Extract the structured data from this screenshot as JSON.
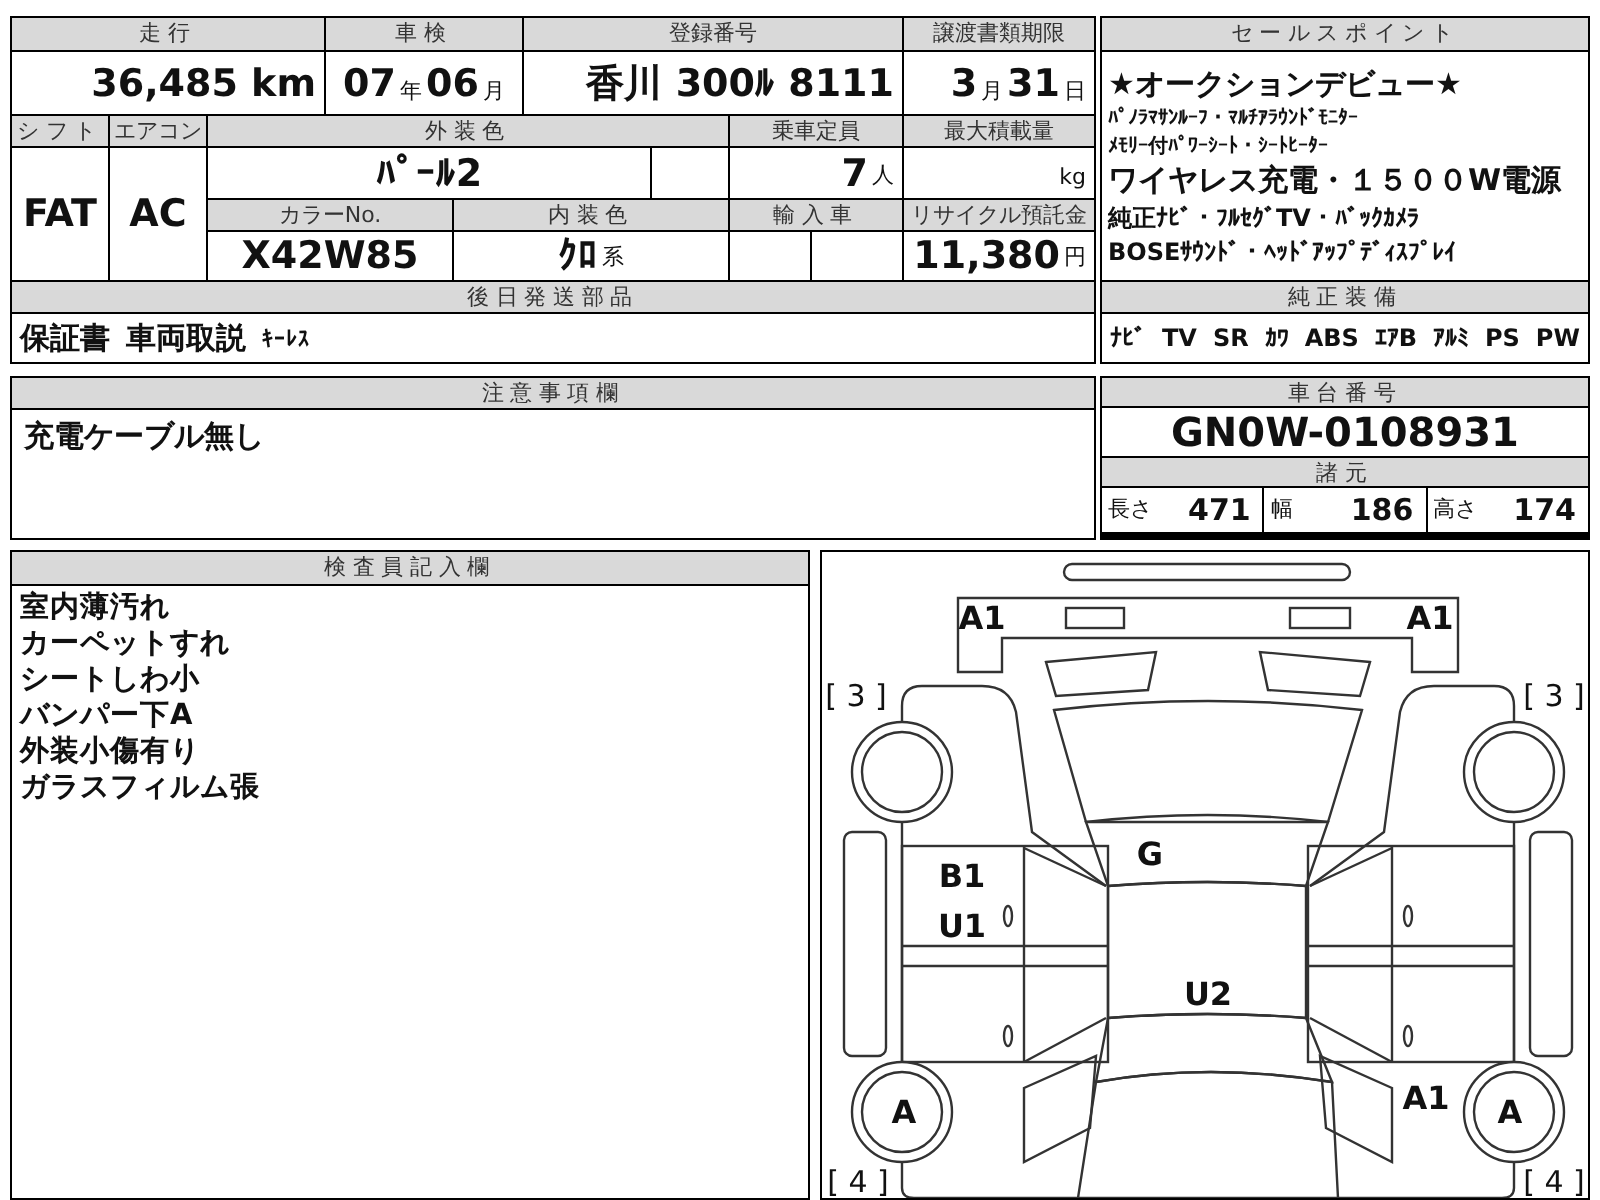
{
  "vehicle": {
    "fields": [
      {
        "label": "走行",
        "parts": [
          {
            "text": "36,485 km",
            "kind": "num"
          }
        ]
      },
      {
        "label": "車検",
        "parts": [
          {
            "text": "07",
            "kind": "num"
          },
          {
            "text": "年",
            "kind": "unit"
          },
          {
            "text": "06",
            "kind": "num"
          },
          {
            "text": "月",
            "kind": "unit"
          }
        ]
      },
      {
        "label": "登録番号",
        "parts": [
          {
            "text": "香川 300ﾙ 8111",
            "kind": "num"
          }
        ]
      },
      {
        "label": "譲渡書類期限",
        "parts": [
          {
            "text": "3",
            "kind": "num"
          },
          {
            "text": "月",
            "kind": "unit"
          },
          {
            "text": "31",
            "kind": "num"
          },
          {
            "text": "日",
            "kind": "unit"
          }
        ]
      },
      {
        "label": "シフト",
        "parts": [
          {
            "text": "FAT",
            "kind": "num"
          }
        ]
      },
      {
        "label": "エアコン",
        "parts": [
          {
            "text": "AC",
            "kind": "num"
          }
        ]
      },
      {
        "label": "外装色",
        "parts": [
          {
            "text": "ﾊﾟｰﾙ2",
            "kind": "num"
          }
        ]
      },
      {
        "label": "乗車定員",
        "parts": [
          {
            "text": "7",
            "kind": "num"
          },
          {
            "text": "人",
            "kind": "unit"
          }
        ]
      },
      {
        "label": "最大積載量",
        "parts": [
          {
            "text": "kg",
            "kind": "unit"
          }
        ]
      },
      {
        "label": "カラーNo.",
        "parts": [
          {
            "text": "X42W85",
            "kind": "num"
          }
        ]
      },
      {
        "label": "内装色",
        "parts": [
          {
            "text": "ｸﾛ",
            "kind": "num"
          },
          {
            "text": "系",
            "kind": "unit"
          }
        ]
      },
      {
        "label": "輸入車"
      },
      {
        "label": "リサイクル預託金",
        "parts": [
          {
            "text": "11,380",
            "kind": "num"
          },
          {
            "text": "円",
            "kind": "unit"
          }
        ]
      }
    ],
    "parts_to_follow": {
      "label": "後日発送部品",
      "items": [
        {
          "text": "保証書",
          "kind": "large"
        },
        {
          "text": "車両取説",
          "kind": "large"
        },
        {
          "text": "ｷｰﾚｽ",
          "kind": "small"
        }
      ]
    }
  },
  "sales_points": {
    "label": "セールスポイント",
    "lines": [
      {
        "text": "★オークションデビュー★",
        "kind": "large"
      },
      {
        "text": "ﾊﾟﾉﾗﾏｻﾝﾙｰﾌ・ﾏﾙﾁｱﾗｳﾝﾄﾞﾓﾆﾀｰ",
        "kind": "small"
      },
      {
        "text": "ﾒﾓﾘｰ付ﾊﾟﾜｰｼｰﾄ・ｼｰﾄﾋｰﾀｰ",
        "kind": "small"
      },
      {
        "text": "ワイヤレス充電・１５００W電源",
        "kind": "large"
      },
      {
        "text": "純正ﾅﾋﾞ・ﾌﾙｾｸﾞTV・ﾊﾞｯｸｶﾒﾗ",
        "kind": "medium"
      },
      {
        "text": "BOSEｻｳﾝﾄﾞ・ﾍｯﾄﾞｱｯﾌﾟﾃﾞｨｽﾌﾟﾚｲ",
        "kind": "medium"
      }
    ]
  },
  "equipment": {
    "label": "純正装備",
    "items": [
      "ﾅﾋﾞ",
      "TV",
      "SR",
      "ｶﾜ",
      "ABS",
      "ｴｱB",
      "ｱﾙﾐ",
      "PS",
      "PW"
    ]
  },
  "notes": {
    "label": "注意事項欄",
    "text": "充電ケーブル無し"
  },
  "chassis": {
    "label": "車台番号",
    "value": "GN0W-0108931"
  },
  "specs": {
    "label": "諸元",
    "items": [
      {
        "label": "長さ",
        "value": "471"
      },
      {
        "label": "幅",
        "value": "186"
      },
      {
        "label": "高さ",
        "value": "174"
      }
    ]
  },
  "inspector": {
    "label": "検査員記入欄",
    "lines": [
      "室内薄汚れ",
      "カーペットすれ",
      "シートしわ小",
      "バンパー下A",
      "外装小傷有り",
      "ガラスフィルム張"
    ]
  },
  "diagram": {
    "marks": [
      {
        "text": "A1"
      },
      {
        "text": "A1"
      },
      {
        "text": "[ 3 ]"
      },
      {
        "text": "[ 3 ]"
      },
      {
        "text": "G"
      },
      {
        "text": "B1"
      },
      {
        "text": "U1"
      },
      {
        "text": "U2"
      },
      {
        "text": "A1"
      },
      {
        "text": "A"
      },
      {
        "text": "A"
      },
      {
        "text": "[ 4 ]"
      },
      {
        "text": "[ 4 ]"
      }
    ]
  }
}
